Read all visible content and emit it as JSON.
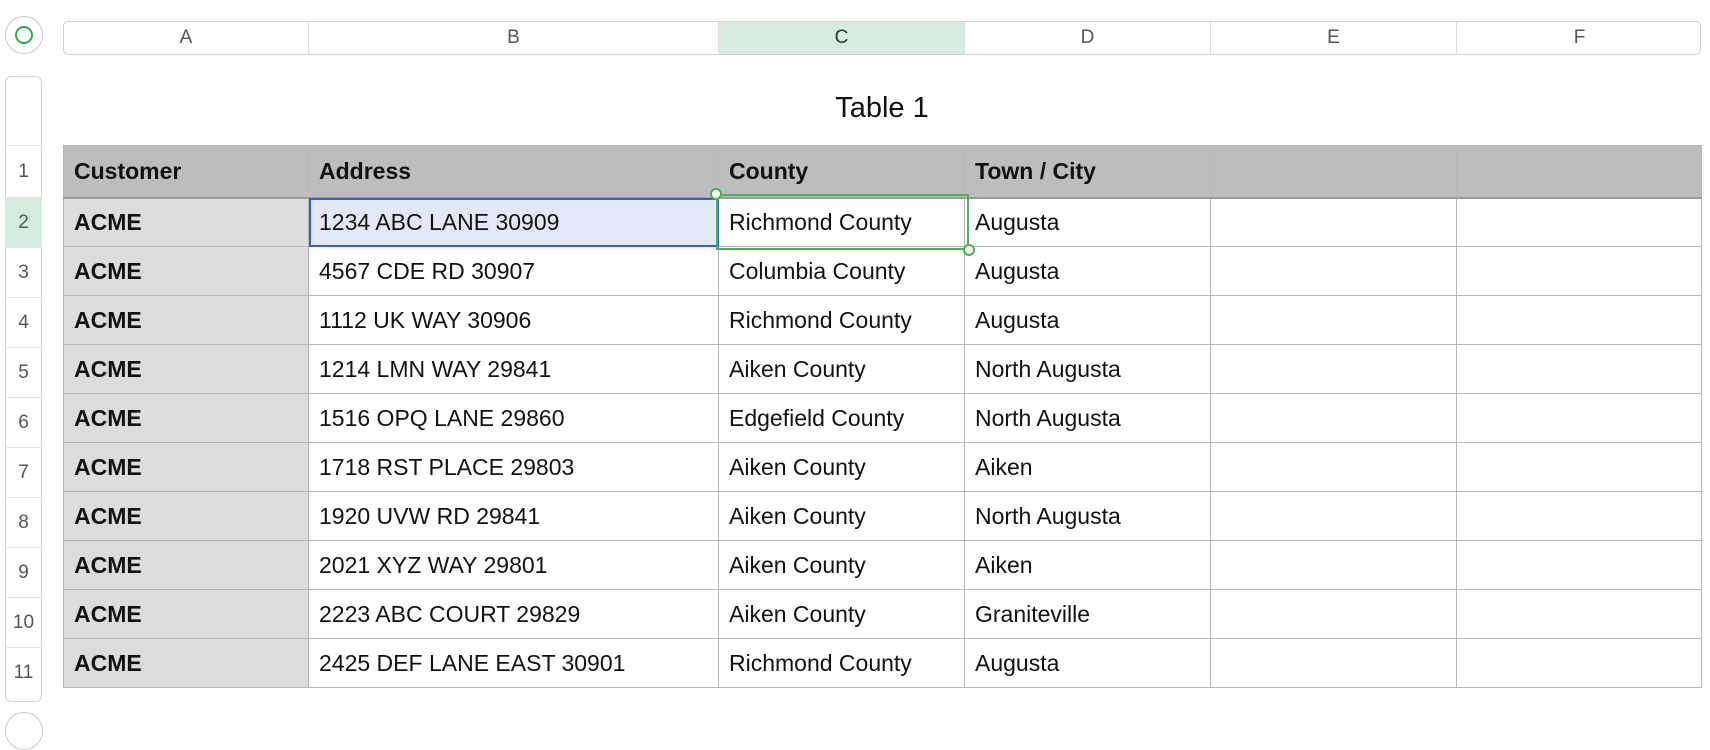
{
  "columns": [
    "A",
    "B",
    "C",
    "D",
    "E",
    "F"
  ],
  "rows": [
    "1",
    "2",
    "3",
    "4",
    "5",
    "6",
    "7",
    "8",
    "9",
    "10",
    "11"
  ],
  "table_title": "Table 1",
  "header": [
    "Customer",
    "Address",
    "County",
    "Town / City",
    "",
    ""
  ],
  "data": [
    [
      "ACME",
      "1234 ABC LANE 30909",
      "Richmond County",
      "Augusta",
      "",
      ""
    ],
    [
      "ACME",
      "4567 CDE RD 30907",
      "Columbia County",
      "Augusta",
      "",
      ""
    ],
    [
      "ACME",
      "1112 UK WAY 30906",
      "Richmond County",
      "Augusta",
      "",
      ""
    ],
    [
      "ACME",
      "1214 LMN WAY 29841",
      "Aiken County",
      "North Augusta",
      "",
      ""
    ],
    [
      "ACME",
      "1516 OPQ LANE 29860",
      "Edgefield County",
      "North Augusta",
      "",
      ""
    ],
    [
      "ACME",
      "1718 RST PLACE 29803",
      "Aiken County",
      "Aiken",
      "",
      ""
    ],
    [
      "ACME",
      "1920 UVW RD 29841",
      "Aiken County",
      "North Augusta",
      "",
      ""
    ],
    [
      "ACME",
      "2021 XYZ WAY 29801",
      "Aiken County",
      "Aiken",
      "",
      ""
    ],
    [
      "ACME",
      "2223 ABC COURT 29829",
      "Aiken County",
      "Graniteville",
      "",
      ""
    ],
    [
      "ACME",
      "2425 DEF LANE EAST 30901",
      "Richmond County",
      "Augusta",
      "",
      ""
    ]
  ],
  "selection": {
    "active_column": "C",
    "active_row": "2"
  },
  "colors": {
    "selected_header": "#d5ece0",
    "selection_green": "#4caf50",
    "cell_blue": "#2f5fd0"
  }
}
